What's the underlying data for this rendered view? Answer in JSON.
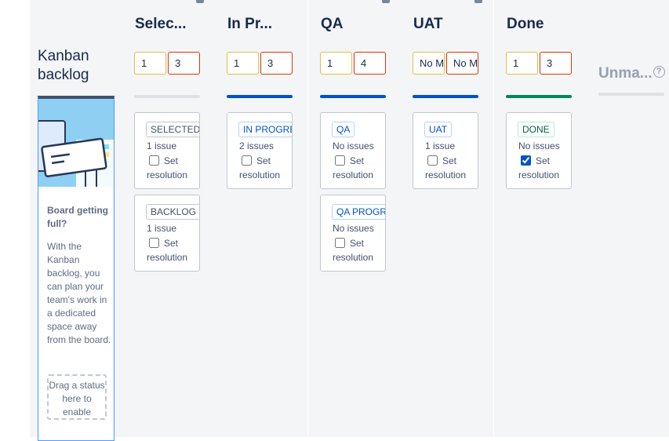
{
  "backlog": {
    "title": "Kanban backlog",
    "heading": "Board getting full?",
    "body": "With the Kanban backlog, you can plan your team's work in a dedicated space away from the board.",
    "drop_zone": "Drag a status here to enable"
  },
  "columns": [
    {
      "title": "Selec...",
      "min": "1",
      "max": "3",
      "bar": "gray",
      "statuses": [
        {
          "name": "SELECTED F",
          "issues": "1 issue",
          "checked": false,
          "style": "gray"
        },
        {
          "name": "BACKLOG",
          "issues": "1 issue",
          "checked": false,
          "style": "gray"
        }
      ]
    },
    {
      "title": "In Pr...",
      "min": "1",
      "max": "3",
      "bar": "blue",
      "statuses": [
        {
          "name": "IN PROGRE",
          "issues": "2 issues",
          "checked": false,
          "style": "blue"
        }
      ]
    },
    {
      "title": "QA",
      "min": "1",
      "max": "4",
      "bar": "blue",
      "statuses": [
        {
          "name": "QA",
          "issues": "No issues",
          "checked": false,
          "style": "blue"
        },
        {
          "name": "QA PROGRE",
          "issues": "No issues",
          "checked": false,
          "style": "blue"
        }
      ]
    },
    {
      "title": "UAT",
      "min": "No M",
      "max": "No M",
      "bar": "blue",
      "statuses": [
        {
          "name": "UAT",
          "issues": "1 issue",
          "checked": false,
          "style": "blue"
        }
      ]
    },
    {
      "title": "Done",
      "min": "1",
      "max": "3",
      "bar": "green",
      "statuses": [
        {
          "name": "DONE",
          "issues": "No issues",
          "checked": true,
          "style": "green"
        }
      ]
    }
  ],
  "set_resolution": {
    "line1": "Set",
    "line2": "resolution"
  },
  "unmapped": {
    "title": "Unma...",
    "help_icon": "question-circle-icon"
  },
  "colors": {
    "accent_blue": "#0052cc",
    "done_green": "#00875a",
    "min_border": "#e2c043",
    "max_border": "#de350b"
  }
}
